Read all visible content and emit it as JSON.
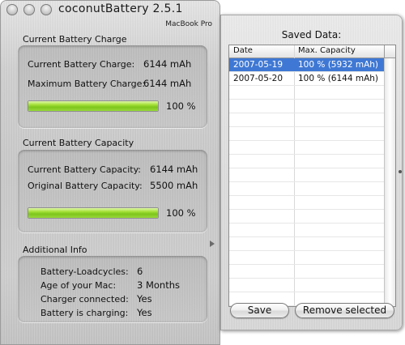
{
  "window": {
    "title": "coconutBattery 2.5.1",
    "mac_model": "MacBook Pro"
  },
  "current_charge": {
    "heading": "Current Battery Charge",
    "current_label": "Current Battery Charge:",
    "current_value": "6144 mAh",
    "max_label": "Maximum Battery Charge:",
    "max_value": "6144 mAh",
    "percent_text": "100 %",
    "percent": 100
  },
  "capacity": {
    "heading": "Current Battery Capacity",
    "current_label": "Current Battery Capacity:",
    "current_value": "6144 mAh",
    "original_label": "Original Battery Capacity:",
    "original_value": "5500 mAh",
    "percent_text": "100 %",
    "percent": 100
  },
  "additional": {
    "heading": "Additional Info",
    "rows": [
      {
        "label": "Battery-Loadcycles:",
        "value": "6"
      },
      {
        "label": "Age of your Mac:",
        "value": "3 Months"
      },
      {
        "label": "Charger connected:",
        "value": "Yes"
      },
      {
        "label": "Battery is charging:",
        "value": "Yes"
      }
    ]
  },
  "saved": {
    "title": "Saved Data:",
    "columns": [
      "Date",
      "Max. Capacity"
    ],
    "rows": [
      {
        "date": "2007-05-19",
        "capacity": "100 % (5932 mAh)",
        "selected": true
      },
      {
        "date": "2007-05-20",
        "capacity": "100 % (6144 mAh)",
        "selected": false
      }
    ],
    "save_label": "Save",
    "remove_label": "Remove selected"
  },
  "colors": {
    "selection": "#3f78d4",
    "bar_green": "#7dc51b"
  }
}
